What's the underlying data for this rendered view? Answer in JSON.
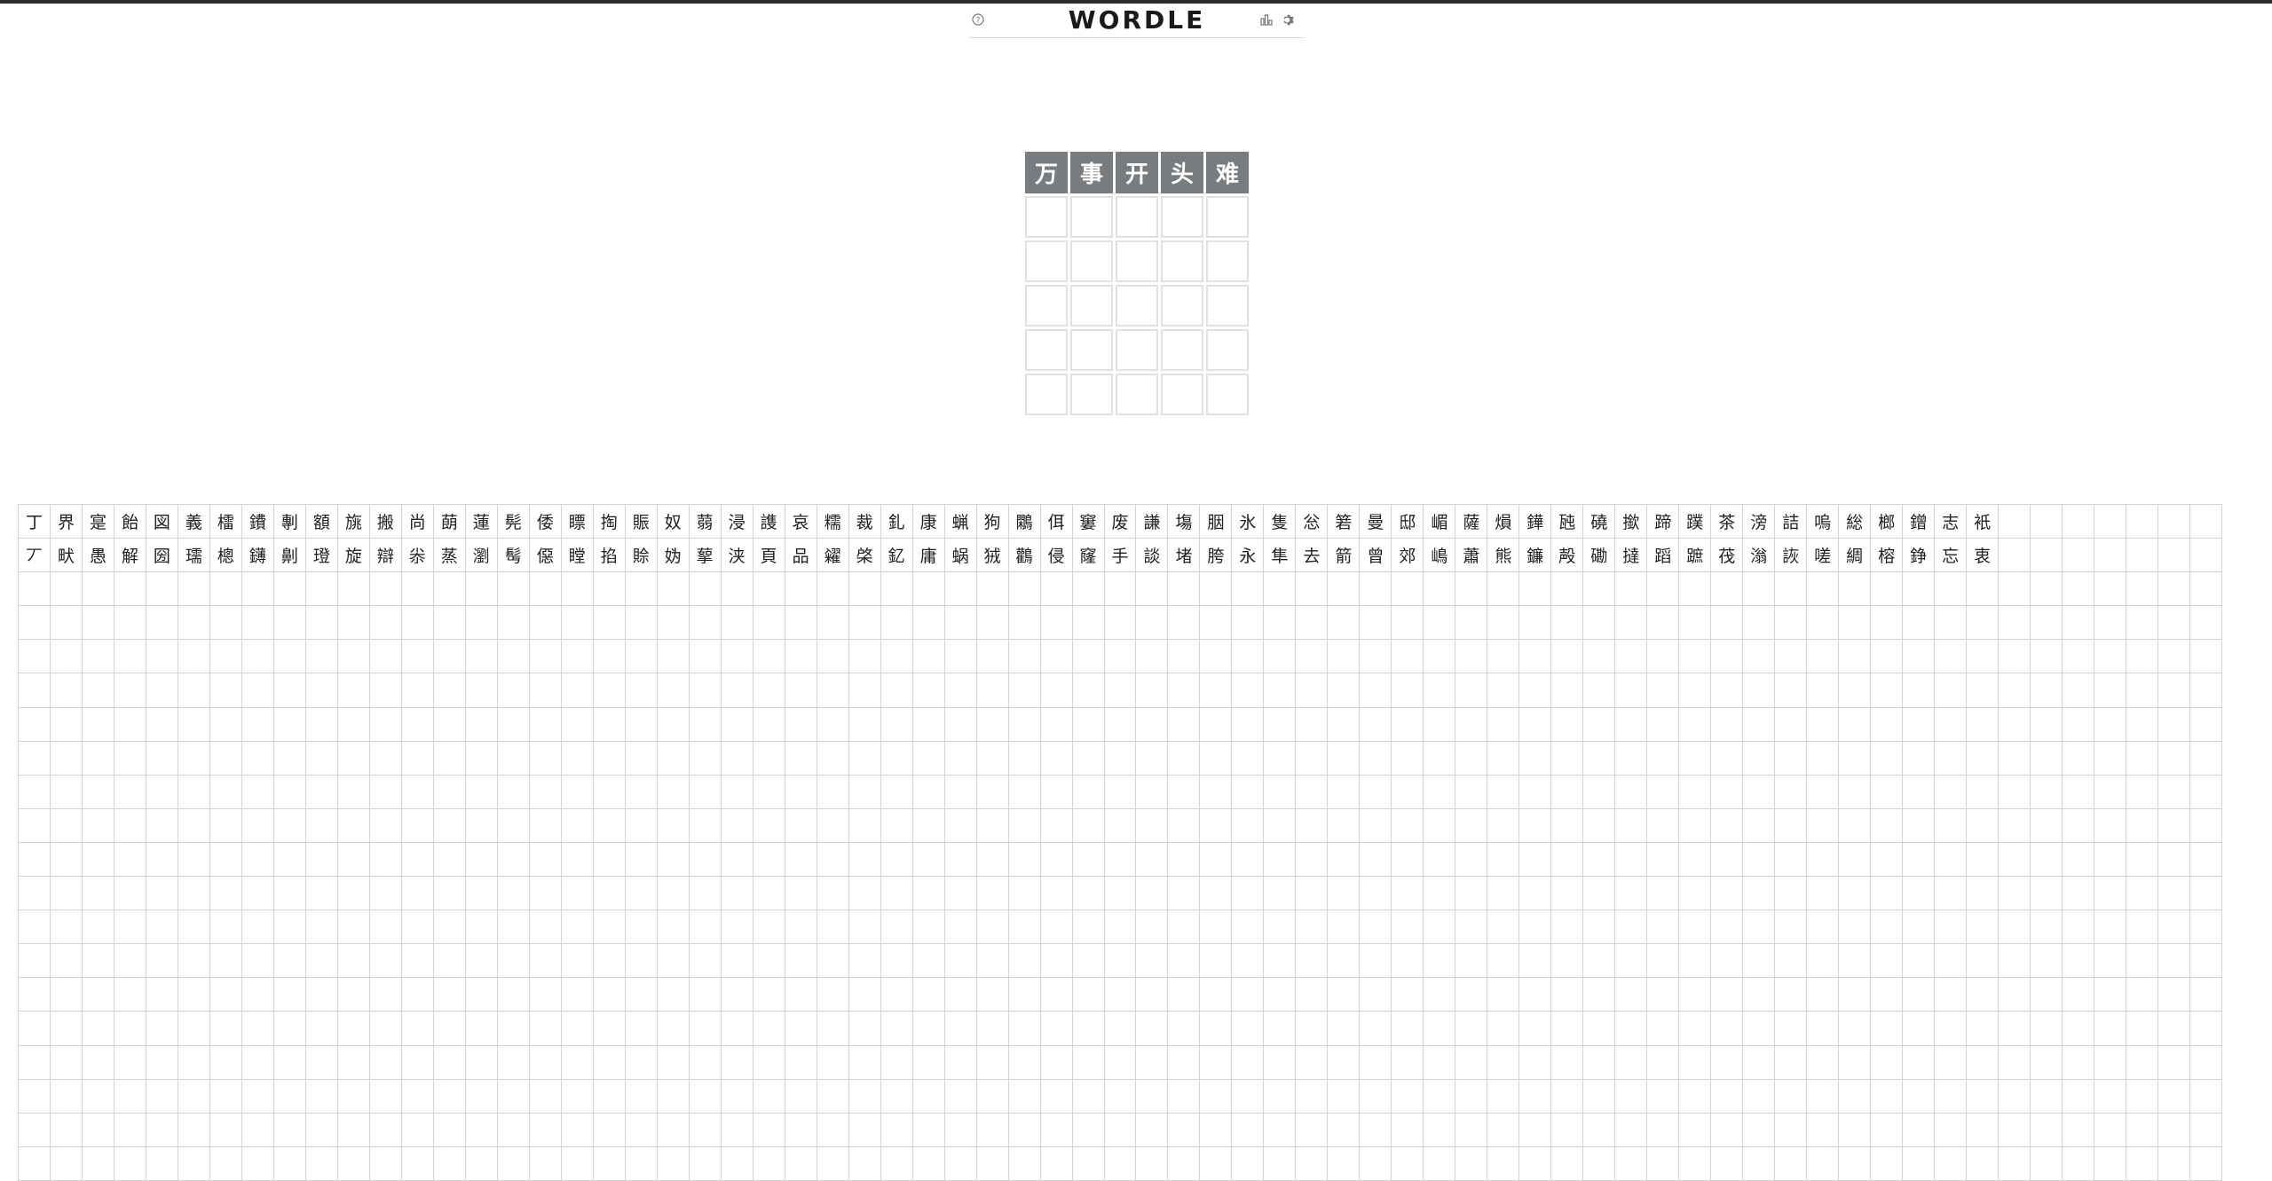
{
  "header": {
    "title": "WORDLE",
    "help_icon": "help-circle-icon",
    "stats_icon": "bar-chart-icon",
    "settings_icon": "gear-icon"
  },
  "board": {
    "rows": [
      [
        "万",
        "事",
        "开",
        "头",
        "难"
      ],
      [
        "",
        "",
        "",
        "",
        ""
      ],
      [
        "",
        "",
        "",
        "",
        ""
      ],
      [
        "",
        "",
        "",
        "",
        ""
      ],
      [
        "",
        "",
        "",
        "",
        ""
      ],
      [
        "",
        "",
        "",
        "",
        ""
      ]
    ]
  },
  "keyboard": {
    "column_heads": [
      "丁",
      "界",
      "寔",
      "飴",
      "図",
      "義",
      "檑",
      "鐨",
      "剸",
      "額",
      "旐",
      "搬",
      "尚",
      "蓢",
      "蓮",
      "髡",
      "倭",
      "瞟",
      "掏",
      "賑",
      "奴",
      "蒻",
      "浸",
      "謢",
      "哀",
      "糯",
      "裁",
      "釓",
      "康",
      "蝋",
      "狗",
      "鷴",
      "佴",
      "窶",
      "废",
      "謙",
      "塲",
      "胭",
      "氷",
      "隻",
      "忩",
      "箬",
      "曼",
      "邸",
      "嵋",
      "薩",
      "熉",
      "鏵",
      "瓲",
      "磽",
      "撳",
      "蹄",
      "蹼",
      "茶",
      "滂",
      "詰",
      "嗚",
      "総",
      "榔",
      "鏳",
      "志",
      "衹"
    ],
    "column_second": [
      "丆",
      "畎",
      "愚",
      "解",
      "圀",
      "瓀",
      "樬",
      "鑮",
      "劓",
      "璒",
      "旋",
      "辯",
      "尜",
      "蒸",
      "瀏",
      "髩",
      "僫",
      "瞠",
      "掐",
      "賒",
      "妫",
      "蒘",
      "浃",
      "頁",
      "品",
      "糴",
      "棨",
      "釔",
      "庸",
      "蜗",
      "狨",
      "鸛",
      "侵",
      "窿",
      "手",
      "談",
      "堵",
      "胯",
      "永",
      "隼",
      "去",
      "箭",
      "曾",
      "郊",
      "嶋",
      "蕭",
      "熊",
      "鐮",
      "殸",
      "磡",
      "撻",
      "蹈",
      "蹠",
      "茷",
      "滃",
      "詼",
      "嗟",
      "綢",
      "榕",
      "錚",
      "忘",
      "衷"
    ]
  }
}
